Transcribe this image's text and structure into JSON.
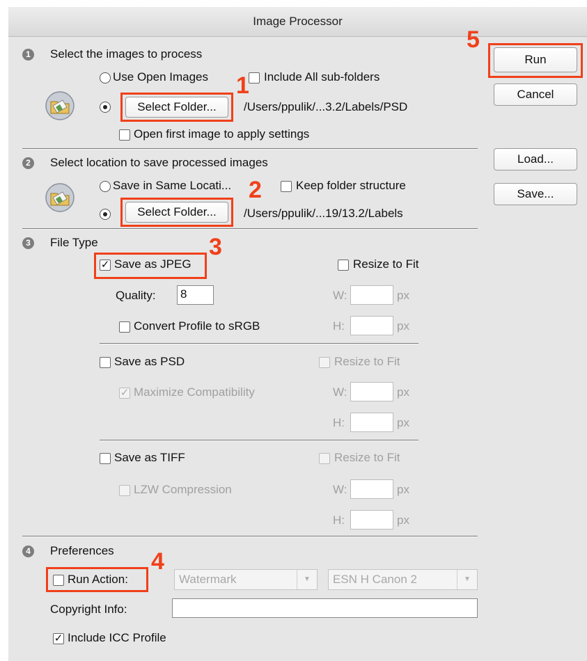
{
  "dialog": {
    "title": "Image Processor"
  },
  "section1": {
    "number": "1",
    "title": "Select the images to process",
    "use_open_images": "Use Open Images",
    "include_subfolders": "Include All sub-folders",
    "select_folder": "Select Folder...",
    "path": "/Users/ppulik/...3.2/Labels/PSD",
    "open_first_image": "Open first image to apply settings"
  },
  "section2": {
    "number": "2",
    "title": "Select location to save processed images",
    "save_same_location": "Save in Same Locati...",
    "keep_folder_structure": "Keep folder structure",
    "select_folder": "Select Folder...",
    "path": "/Users/ppulik/...19/13.2/Labels"
  },
  "section3": {
    "number": "3",
    "title": "File Type",
    "jpeg": {
      "label": "Save as JPEG",
      "checked": true,
      "resize": "Resize to Fit",
      "quality_label": "Quality:",
      "quality_value": "8",
      "convert_profile": "Convert Profile to sRGB",
      "w": "W:",
      "h": "H:",
      "px": "px"
    },
    "psd": {
      "label": "Save as PSD",
      "resize": "Resize to Fit",
      "maximize": "Maximize Compatibility",
      "w": "W:",
      "h": "H:",
      "px": "px"
    },
    "tiff": {
      "label": "Save as TIFF",
      "resize": "Resize to Fit",
      "lzw": "LZW Compression",
      "w": "W:",
      "h": "H:",
      "px": "px"
    }
  },
  "section4": {
    "number": "4",
    "title": "Preferences",
    "run_action": "Run Action:",
    "action_set": "Watermark",
    "action": "ESN H Canon 2",
    "copyright_label": "Copyright Info:",
    "copyright_value": "",
    "include_icc": "Include ICC Profile"
  },
  "buttons": {
    "run": "Run",
    "cancel": "Cancel",
    "load": "Load...",
    "save": "Save..."
  },
  "callouts": [
    "1",
    "2",
    "3",
    "4",
    "5"
  ],
  "colors": {
    "highlight": "#f0401a",
    "dialog_bg": "#e6e6e6"
  },
  "icons": {
    "checkmark": "✓",
    "dropdown": "▼"
  }
}
